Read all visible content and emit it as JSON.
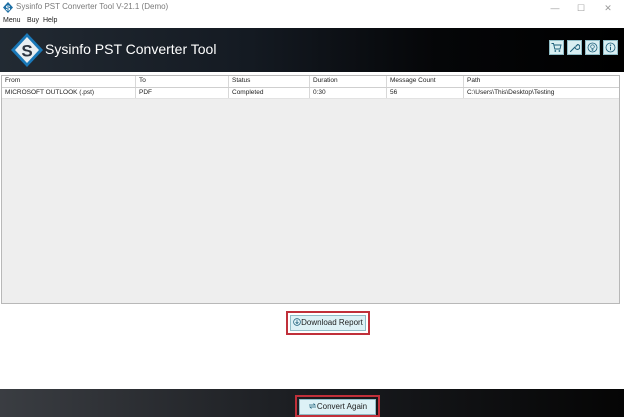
{
  "window": {
    "title": "Sysinfo PST Converter Tool V-21.1 (Demo)",
    "controls": {
      "minimize": "—",
      "maximize": "☐",
      "close": "✕"
    }
  },
  "menu": [
    "Menu",
    "Buy",
    "Help"
  ],
  "banner": {
    "logo_letter": "S",
    "title": "Sysinfo PST Converter Tool",
    "tools": [
      "cart-icon",
      "wrench-icon",
      "bulb-icon",
      "info-icon"
    ]
  },
  "table": {
    "headers": [
      "From",
      "To",
      "Status",
      "Duration",
      "Message Count",
      "Path"
    ],
    "rows": [
      [
        "MICROSOFT OUTLOOK (.pst)",
        "PDF",
        "Completed",
        "0:30",
        "56",
        "C:\\Users\\This\\Desktop\\Testing"
      ]
    ]
  },
  "buttons": {
    "download_report": "Download Report",
    "convert_again": "Convert Again"
  },
  "colors": {
    "accent": "#c0303a",
    "button_bg": "#ddf1f6",
    "banner_dark": "#000000"
  }
}
